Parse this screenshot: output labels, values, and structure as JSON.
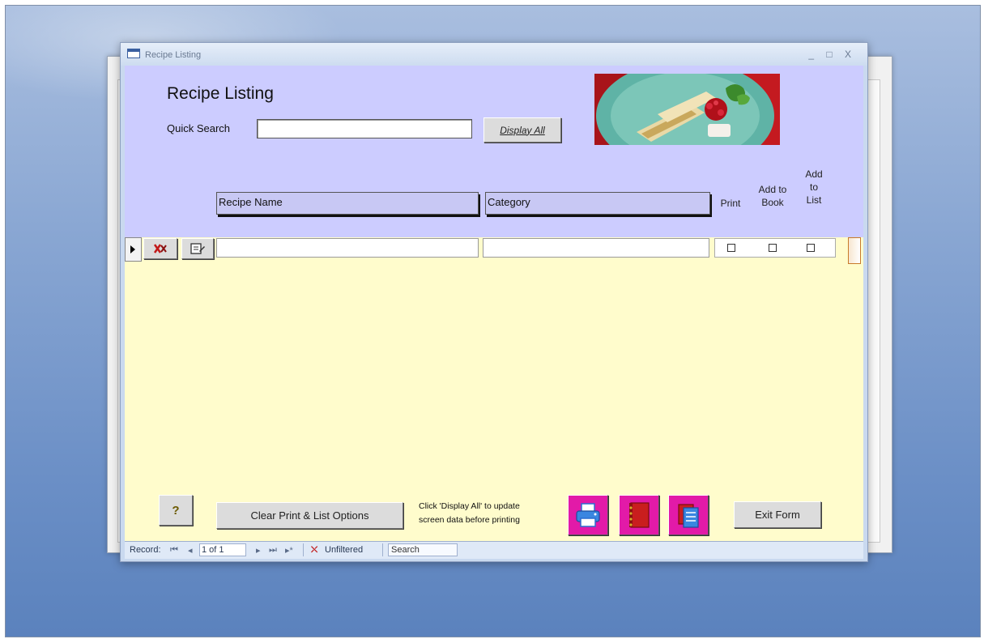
{
  "window": {
    "title": "Recipe Listing",
    "controls": [
      "_",
      "□",
      "X"
    ]
  },
  "form": {
    "title": "Recipe Listing",
    "quick_search_label": "Quick Search",
    "quick_search_value": "",
    "display_all_label": "Display All"
  },
  "columns": {
    "recipe_name": "Recipe Name",
    "category": "Category",
    "print": "Print",
    "add_to_book": [
      "Add to",
      "Book"
    ],
    "add_to_list": [
      "Add",
      "to",
      "List"
    ]
  },
  "rows": [
    {
      "recipe_name": "",
      "category": "",
      "print": false,
      "add_to_book": false,
      "add_to_list": false
    }
  ],
  "footer": {
    "help_glyph": "?",
    "clear_label": "Clear Print & List Options",
    "note_lines": [
      "Click 'Display All' to update",
      "screen data before printing"
    ],
    "exit_label": "Exit Form",
    "icons": [
      "printer-icon",
      "book-icon",
      "list-icon"
    ]
  },
  "statusbar": {
    "record_label": "Record:",
    "first": "⏮",
    "prev": "◂",
    "position": "1 of 1",
    "next": "▸",
    "last": "⏭",
    "new": "▸*",
    "filter_label": "Unfiltered",
    "search_label": "Search"
  }
}
